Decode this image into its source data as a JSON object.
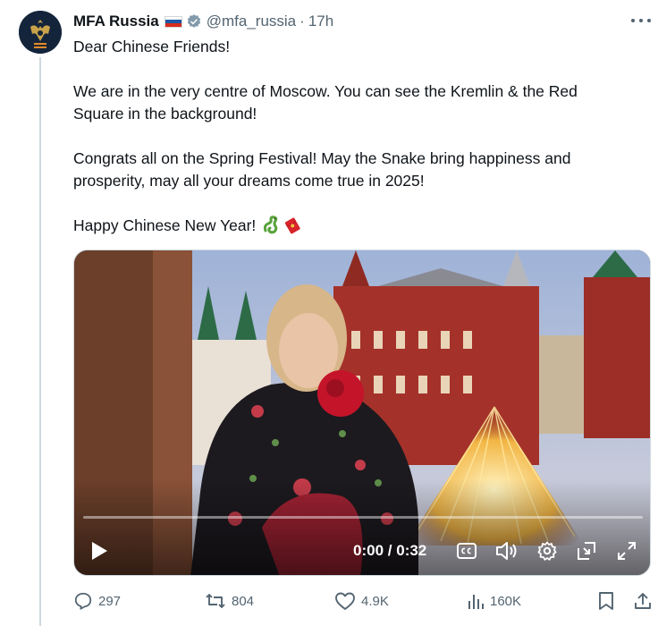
{
  "post": {
    "author_name": "MFA Russia",
    "author_flag": "russia-flag-emoji",
    "handle": "@mfa_russia",
    "separator": "·",
    "time": "17h",
    "text": {
      "line1": "Dear Chinese Friends!",
      "line2": "We are in the very centre of Moscow. You can see the Kremlin & the Red",
      "line3": "Square in the background!",
      "line4": "Congrats all on the Spring Festival! May the Snake bring happiness and",
      "line5": "prosperity, may all your dreams come true in 2025!",
      "line6": "Happy Chinese New Year!",
      "emojis": [
        "snake-emoji",
        "red-envelope-emoji"
      ]
    },
    "video": {
      "current_time": "0:00",
      "separator": "/",
      "duration": "0:32",
      "progress": 0
    }
  },
  "stats": {
    "replies": "297",
    "reposts": "804",
    "likes": "4.9K",
    "views": "160K"
  },
  "colors": {
    "text_primary": "#0f1419",
    "text_secondary": "#536471",
    "verified": "#829aab",
    "avatar_bg": "#14243b"
  }
}
